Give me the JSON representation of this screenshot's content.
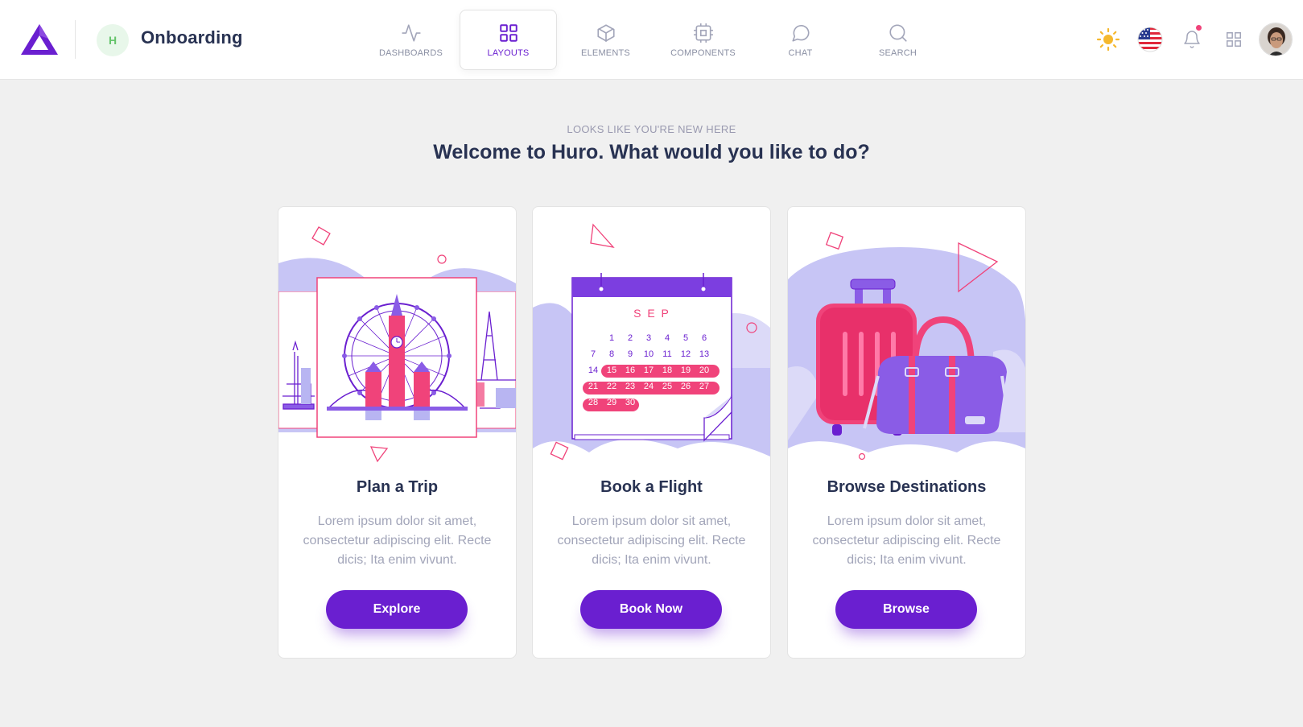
{
  "header": {
    "project_initial": "H",
    "page_title": "Onboarding"
  },
  "nav_tabs": [
    {
      "label": "DASHBOARDS",
      "icon": "activity-icon",
      "active": false
    },
    {
      "label": "LAYOUTS",
      "icon": "grid-icon",
      "active": true
    },
    {
      "label": "ELEMENTS",
      "icon": "box-icon",
      "active": false
    },
    {
      "label": "COMPONENTS",
      "icon": "cpu-icon",
      "active": false
    },
    {
      "label": "CHAT",
      "icon": "chat-bubble-icon",
      "active": false
    },
    {
      "label": "SEARCH",
      "icon": "search-icon",
      "active": false
    }
  ],
  "toolbar": {
    "icons": [
      "sun-icon",
      "us-flag-icon",
      "bell-icon",
      "apps-grid-icon",
      "user-avatar"
    ]
  },
  "hero": {
    "eyebrow": "LOOKS LIKE YOU'RE NEW HERE",
    "headline": "Welcome to Huro. What would you like to do?"
  },
  "cards": [
    {
      "title": "Plan a Trip",
      "text": "Lorem ipsum dolor sit amet, consectetur adipiscing elit. Recte dicis; Ita enim vivunt.",
      "button": "Explore",
      "illustration": "city-landmarks-illustration"
    },
    {
      "title": "Book a Flight",
      "text": "Lorem ipsum dolor sit amet, consectetur adipiscing elit. Recte dicis; Ita enim vivunt.",
      "button": "Book Now",
      "illustration": "calendar-illustration"
    },
    {
      "title": "Browse Destinations",
      "text": "Lorem ipsum dolor sit amet, consectetur adipiscing elit. Recte dicis; Ita enim vivunt.",
      "button": "Browse",
      "illustration": "luggage-illustration"
    }
  ],
  "calendar": {
    "month": "S E P",
    "days": [
      "1",
      "2",
      "3",
      "4",
      "5",
      "6",
      "7",
      "8",
      "9",
      "10",
      "11",
      "12",
      "13",
      "14",
      "15",
      "16",
      "17",
      "18",
      "19",
      "20",
      "21",
      "22",
      "23",
      "24",
      "25",
      "26",
      "27",
      "28",
      "29",
      "30"
    ]
  },
  "colors": {
    "brand_purple": "#6a1fd0",
    "accent_pink": "#f0437a",
    "lavender": "#b8b5f2",
    "page_bg": "#f0f0f0"
  }
}
